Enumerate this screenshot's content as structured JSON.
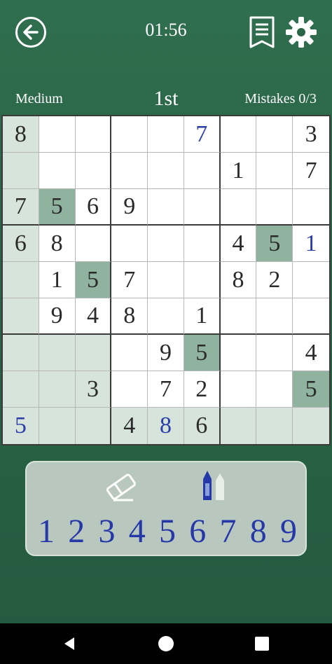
{
  "header": {
    "timer": "01:56",
    "back_icon": "back-arrow-icon",
    "notes_icon": "notes-icon",
    "settings_icon": "gear-icon"
  },
  "info": {
    "difficulty": "Medium",
    "rank": "1st",
    "mistakes": "Mistakes 0/3"
  },
  "grid": {
    "rows": [
      [
        "8",
        "",
        "",
        "",
        "",
        "7",
        "",
        "",
        "3"
      ],
      [
        "",
        "",
        "",
        "",
        "",
        "",
        "1",
        "",
        "7"
      ],
      [
        "7",
        "5",
        "6",
        "9",
        "",
        "",
        "",
        "",
        ""
      ],
      [
        "6",
        "8",
        "",
        "",
        "",
        "",
        "4",
        "5",
        "1"
      ],
      [
        "",
        "1",
        "5",
        "7",
        "",
        "",
        "8",
        "2",
        ""
      ],
      [
        "",
        "9",
        "4",
        "8",
        "",
        "1",
        "",
        "",
        ""
      ],
      [
        "",
        "",
        "",
        "",
        "9",
        "5",
        "",
        "",
        "4"
      ],
      [
        "",
        "",
        "3",
        "",
        "7",
        "2",
        "",
        "",
        "5"
      ],
      [
        "5",
        "",
        "",
        "4",
        "8",
        "6",
        "",
        "",
        ""
      ]
    ],
    "user_entered": [
      [
        0,
        5
      ],
      [
        3,
        8
      ],
      [
        8,
        0
      ],
      [
        8,
        4
      ]
    ],
    "highlighted_cells": [
      [
        0,
        0
      ],
      [
        1,
        0
      ],
      [
        2,
        0
      ],
      [
        3,
        0
      ],
      [
        4,
        0
      ],
      [
        5,
        0
      ],
      [
        6,
        0
      ],
      [
        7,
        0
      ],
      [
        8,
        0
      ],
      [
        8,
        1
      ],
      [
        8,
        2
      ],
      [
        8,
        3
      ],
      [
        8,
        4
      ],
      [
        8,
        5
      ],
      [
        8,
        6
      ],
      [
        8,
        7
      ],
      [
        8,
        8
      ],
      [
        6,
        0
      ],
      [
        6,
        1
      ],
      [
        6,
        2
      ],
      [
        7,
        0
      ],
      [
        7,
        1
      ],
      [
        7,
        2
      ]
    ],
    "same_number_cells": [
      [
        2,
        1
      ],
      [
        3,
        7
      ],
      [
        4,
        2
      ],
      [
        6,
        5
      ],
      [
        7,
        8
      ]
    ],
    "colors": {
      "background": "#2a6447",
      "highlight": "#d6e4dc",
      "same_number": "#8fb39f",
      "user_digit": "#2b3ea8",
      "given_digit": "#2a2a2a"
    }
  },
  "pad": {
    "eraser_icon": "eraser-icon",
    "pencil_icon": "pencil-notes-icon",
    "digits": [
      "1",
      "2",
      "3",
      "4",
      "5",
      "6",
      "7",
      "8",
      "9"
    ]
  },
  "navbar": {
    "back_icon": "nav-back-icon",
    "home_icon": "nav-home-icon",
    "recent_icon": "nav-recents-icon"
  }
}
